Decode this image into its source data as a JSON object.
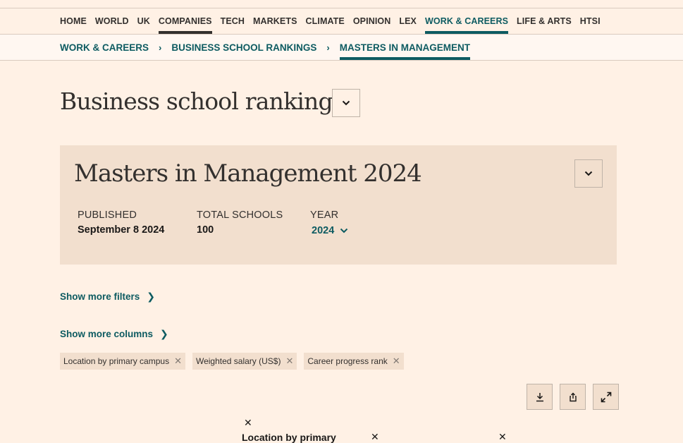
{
  "nav": {
    "items": [
      {
        "label": "HOME"
      },
      {
        "label": "WORLD"
      },
      {
        "label": "UK"
      },
      {
        "label": "COMPANIES"
      },
      {
        "label": "TECH"
      },
      {
        "label": "MARKETS"
      },
      {
        "label": "CLIMATE"
      },
      {
        "label": "OPINION"
      },
      {
        "label": "LEX"
      },
      {
        "label": "WORK & CAREERS"
      },
      {
        "label": "LIFE & ARTS"
      },
      {
        "label": "HTSI"
      }
    ]
  },
  "breadcrumb": {
    "items": [
      {
        "label": "WORK & CAREERS"
      },
      {
        "label": "BUSINESS SCHOOL RANKINGS"
      },
      {
        "label": "MASTERS IN MANAGEMENT"
      }
    ],
    "separator": "›"
  },
  "page": {
    "title": "Business school rankings"
  },
  "ranking": {
    "title": "Masters in Management 2024",
    "published_label": "PUBLISHED",
    "published_value": "September 8 2024",
    "total_label": "TOTAL SCHOOLS",
    "total_value": "100",
    "year_label": "YEAR",
    "year_value": "2024"
  },
  "filters": {
    "more_filters": "Show more filters",
    "more_columns": "Show more columns",
    "arrow": "❯",
    "chips": [
      {
        "label": "Location by primary campus"
      },
      {
        "label": "Weighted salary (US$)"
      },
      {
        "label": "Career progress rank"
      }
    ],
    "chip_remove": "✕"
  },
  "table": {
    "remove_mark": "✕",
    "first_column_header": "Location by primary"
  },
  "colors": {
    "background": "#FFF1E5",
    "panel": "#F2DFCE",
    "teal": "#0D5B61",
    "text": "#33302E"
  },
  "icons": {
    "download": "download-icon",
    "share": "share-icon",
    "expand": "expand-icon",
    "dropdown": "chevron-down-icon"
  }
}
